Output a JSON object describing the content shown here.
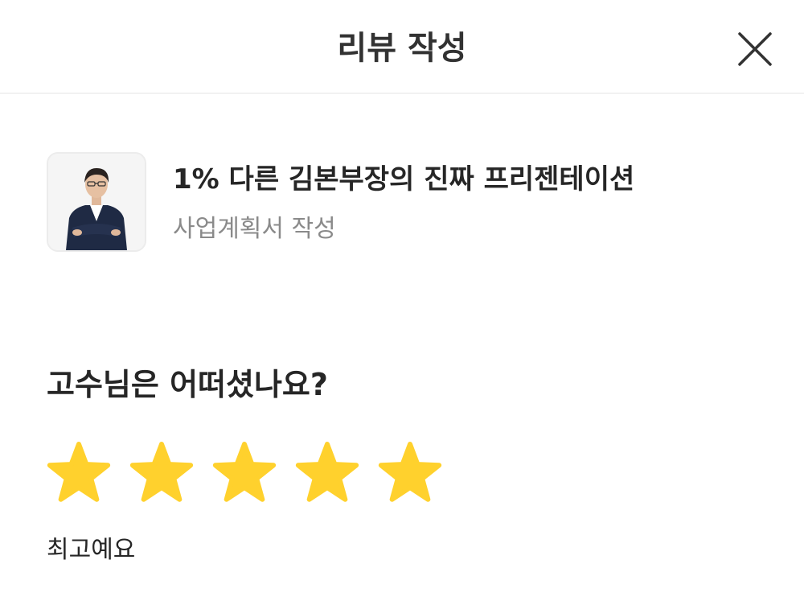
{
  "header": {
    "title": "리뷰 작성",
    "close_icon": "close-icon"
  },
  "product": {
    "title": "1% 다른 김본부장의 진짜 프리젠테이션",
    "subtitle": "사업계획서 작성",
    "thumbnail": "instructor-photo"
  },
  "rating": {
    "question": "고수님은 어떠셨나요?",
    "value": 5,
    "max": 5,
    "star_icon": "star-icon",
    "label": "최고예요",
    "star_color": "#FFD12D"
  }
}
